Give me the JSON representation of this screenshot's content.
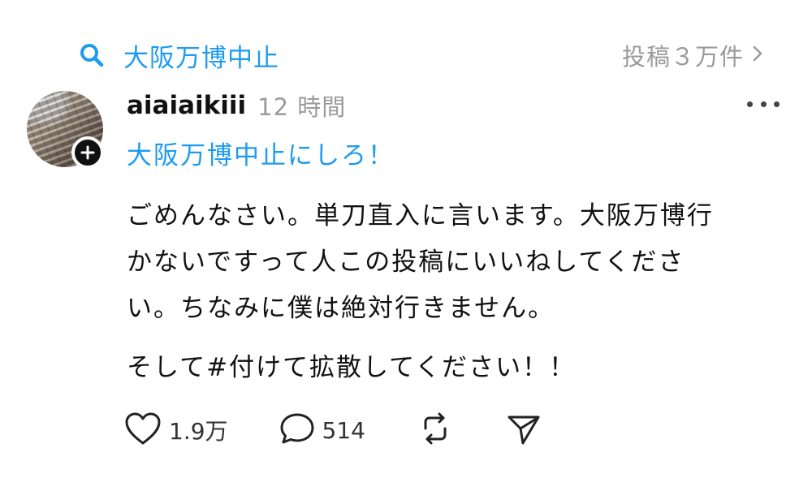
{
  "topic_bar": {
    "icon": "search-icon",
    "title": "大阪万博中止",
    "post_count": "投稿３万件",
    "accent_color": "#1d9bf0"
  },
  "post": {
    "username": "aiaiaikiii",
    "timestamp": "12 時間",
    "topic_tag": "大阪万博中止にしろ！",
    "body_lines": [
      "ごめんなさい。単刀直入に言います。大阪万博行",
      "かないですって人この投稿にいいねしてくださ",
      "い。ちなみに僕は絶対行きません。"
    ],
    "body_last": "そして#付けて拡散してください！！"
  },
  "actions": {
    "likes": "1.9万",
    "replies": "514"
  }
}
